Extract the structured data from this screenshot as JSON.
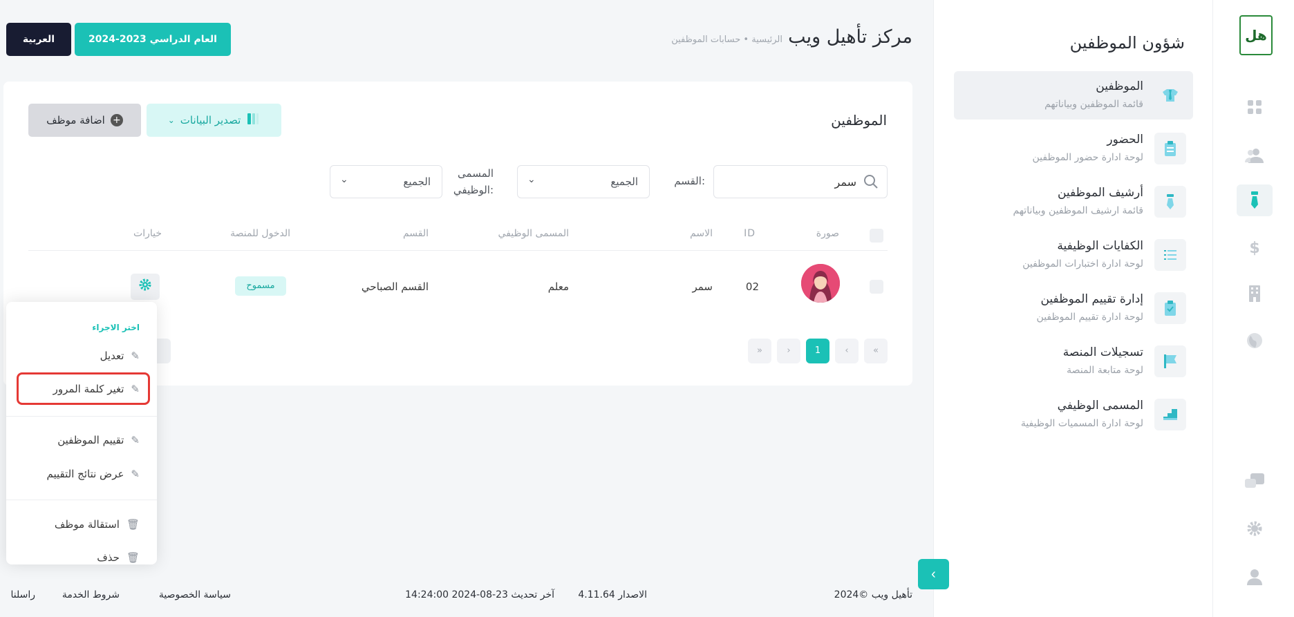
{
  "rail": {
    "logo_text": "هل",
    "icons": [
      "grid-icon",
      "users-icon",
      "employee-tie-icon",
      "dollar-icon",
      "building-icon",
      "globe-icon",
      "chat-icon",
      "gear-icon",
      "user-icon"
    ]
  },
  "sidebar": {
    "title": "شؤون الموظفين",
    "items": [
      {
        "label": "الموظفين",
        "sub": "قائمة الموظفين وبياناتهم"
      },
      {
        "label": "الحضور",
        "sub": "لوحة ادارة حضور الموظفين"
      },
      {
        "label": "أرشيف الموظفين",
        "sub": "قائمة ارشيف الموظفين وبياناتهم"
      },
      {
        "label": "الكفايات الوظيفية",
        "sub": "لوحة ادارة اختبارات الموظفين"
      },
      {
        "label": "إدارة تقييم الموظفين",
        "sub": "لوحة ادارة تقييم الموظفين"
      },
      {
        "label": "تسجيلات المنصة",
        "sub": "لوحة متابعة المنصة"
      },
      {
        "label": "المسمى الوظيفي",
        "sub": "لوحة ادارة المسميات الوظيفية"
      }
    ]
  },
  "header": {
    "site_title": "مركز تأهيل ويب",
    "breadcrumb": "الرئيسية • حسابات الموظفين",
    "year_button": "العام الدراسي 2023-2024",
    "lang_button": "العربية"
  },
  "card": {
    "title": "الموظفين",
    "export_button": "تصدير البيانات",
    "add_button": "اضافة موظف",
    "search_value": "سمر",
    "dept_label": "القسم:",
    "dept_value": "الجميع",
    "job_label_line1": "المسمى",
    "job_label_line2": "الوظيفي:",
    "job_value": "الجميع"
  },
  "table": {
    "headers": {
      "photo": "صورة",
      "id": "ID",
      "name": "الاسم",
      "job": "المسمى الوظيفي",
      "dept": "القسم",
      "access": "الدخول للمنصة",
      "options": "خيارات"
    },
    "rows": [
      {
        "id": "02",
        "name": "سمر",
        "job": "معلم",
        "dept": "القسم الصباحي",
        "access": "مسموح"
      }
    ]
  },
  "pagination": {
    "first": "«",
    "prev": "‹",
    "current": "1",
    "next": "›",
    "last": "»"
  },
  "menu": {
    "heading": "اختر الاجراء",
    "items": [
      "تعديل",
      "تغير كلمة المرور",
      "تقييم الموظفين",
      "عرض نتائج التقييم",
      "استقالة موظف",
      "حذف"
    ]
  },
  "footer": {
    "copyright": "2024© تأهيل ويب",
    "version": "الاصدار 4.11.64",
    "updated": "آخر تحديث 23-08-2024 14:24:00",
    "privacy": "سياسة الخصوصية",
    "terms": "شروط الخدمة",
    "contact": "راسلنا"
  },
  "colors": {
    "accent": "#1bc1b6",
    "dark": "#181c32",
    "danger": "#e53935"
  }
}
